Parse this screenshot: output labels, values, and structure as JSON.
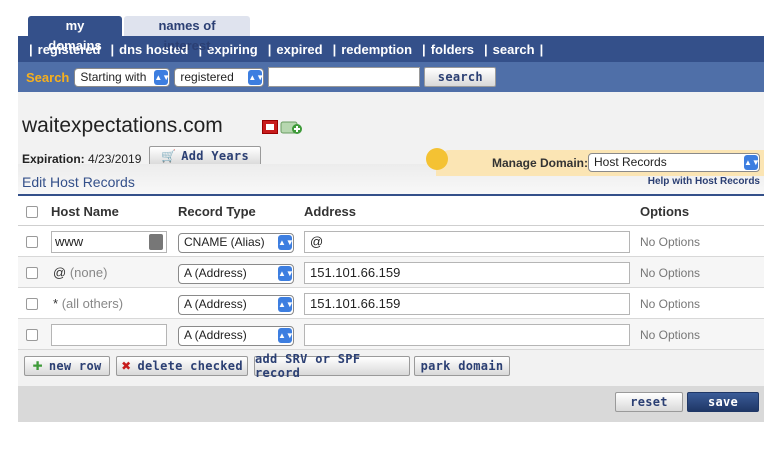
{
  "tabs": [
    {
      "label": "my domains",
      "active": true
    },
    {
      "label": "names of interest",
      "active": false
    }
  ],
  "nav": [
    "registered",
    "dns hosted",
    "expiring",
    "expired",
    "redemption",
    "folders",
    "search"
  ],
  "search": {
    "label": "Search",
    "mode": "Starting with",
    "scope": "registered",
    "query": "",
    "button": "search"
  },
  "domain": {
    "name": "waitexpectations.com",
    "expiration_label": "Expiration:",
    "expiration_date": "4/23/2019",
    "add_years": "Add Years"
  },
  "manage": {
    "label": "Manage Domain:",
    "value": "Host Records"
  },
  "section": {
    "title": "Edit Host Records",
    "help": "Help with Host Records"
  },
  "table": {
    "headers": {
      "host": "Host Name",
      "type": "Record Type",
      "address": "Address",
      "options": "Options"
    },
    "rows": [
      {
        "host": "www",
        "host_note": "",
        "type": "CNAME (Alias)",
        "address": "@",
        "options": "No Options"
      },
      {
        "host": "@",
        "host_note": "(none)",
        "type": "A (Address)",
        "address": "151.101.66.159",
        "options": "No Options"
      },
      {
        "host": "*",
        "host_note": "(all others)",
        "type": "A (Address)",
        "address": "151.101.66.159",
        "options": "No Options"
      },
      {
        "host": "",
        "host_note": "",
        "type": "A (Address)",
        "address": "",
        "options": "No Options"
      }
    ]
  },
  "actions": {
    "new_row": "new row",
    "delete_checked": "delete checked",
    "add_srv": "add SRV or SPF record",
    "park": "park domain"
  },
  "footer": {
    "reset": "reset",
    "save": "save"
  },
  "colors": {
    "nav": "#34508a",
    "search_bar": "#4f6fa8",
    "search_label": "#f6b01e",
    "manage_bg": "#fbe5b4"
  }
}
